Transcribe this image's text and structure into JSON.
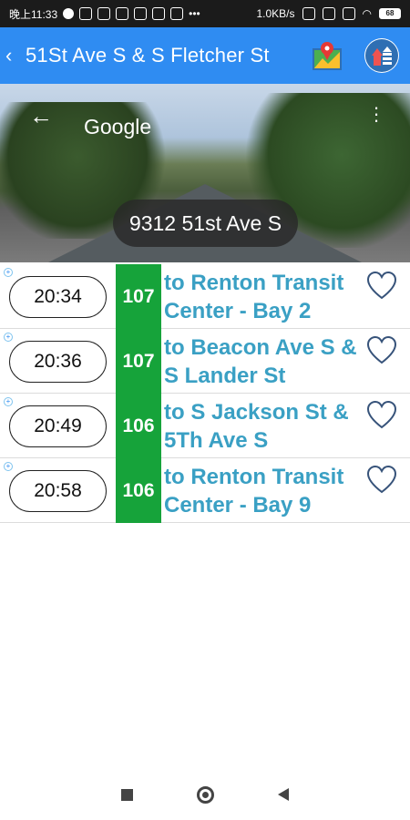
{
  "status_bar": {
    "time": "晚上11:33",
    "network_speed": "1.0KB/s",
    "battery": "68"
  },
  "header": {
    "back_icon": "chevron-left-icon",
    "title": "51St Ave S & S Fletcher St",
    "map_icon": "map-pin-icon",
    "upload_icon": "upload-icon",
    "color": "#2f8cf2"
  },
  "street_view": {
    "back_arrow": "←",
    "brand": "Google",
    "address": "9312 51st Ave S"
  },
  "departures": [
    {
      "time": "20:34",
      "route": "107",
      "destination": "to Renton Transit Center - Bay 2"
    },
    {
      "time": "20:36",
      "route": "107",
      "destination": "to Beacon Ave S & S Lander St"
    },
    {
      "time": "20:49",
      "route": "106",
      "destination": "to S Jackson St & 5Th Ave S"
    },
    {
      "time": "20:58",
      "route": "106",
      "destination": "to Renton Transit Center - Bay 9"
    }
  ],
  "colors": {
    "route_bg": "#16a33a",
    "destination_text": "#3aa0c4"
  }
}
